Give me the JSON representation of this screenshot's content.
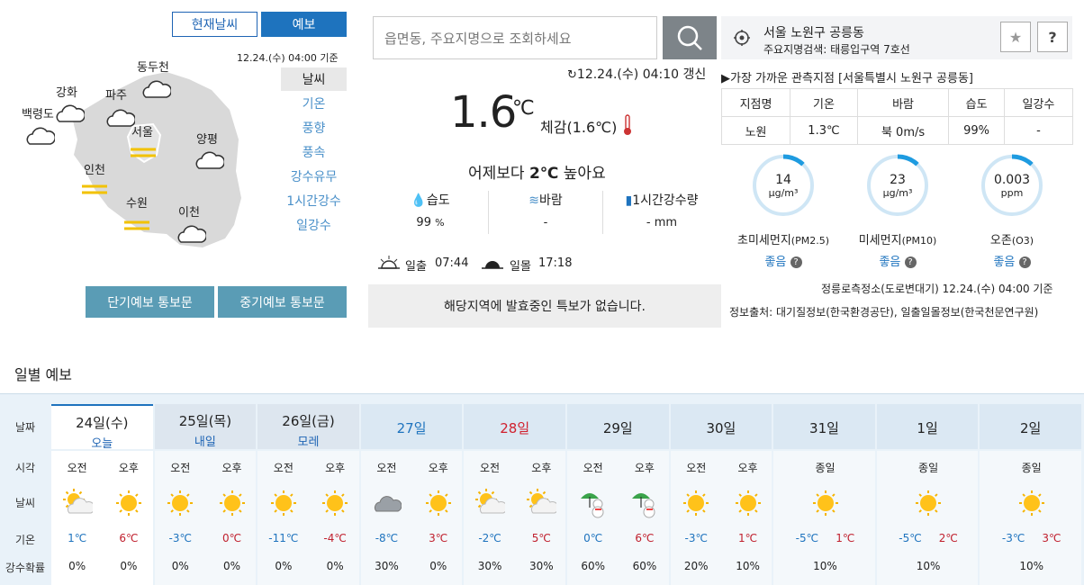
{
  "tabs": {
    "current": "현재날씨",
    "forecast": "예보"
  },
  "map": {
    "timestamp": "12.24.(수) 04:00 기준",
    "cities": [
      {
        "name": "동두천",
        "icon": "cloud-icon"
      },
      {
        "name": "강화",
        "icon": "cloud-icon"
      },
      {
        "name": "파주",
        "icon": "cloud-icon"
      },
      {
        "name": "백령도",
        "icon": "cloud-icon"
      },
      {
        "name": "서울",
        "icon": "fog-icon"
      },
      {
        "name": "양평",
        "icon": "cloud-icon"
      },
      {
        "name": "인천",
        "icon": "fog-icon"
      },
      {
        "name": "수원",
        "icon": "fog-icon"
      },
      {
        "name": "이천",
        "icon": "cloud-icon"
      }
    ],
    "menu": [
      "날씨",
      "기온",
      "풍향",
      "풍속",
      "강수유무",
      "1시간강수",
      "일강수"
    ],
    "short_report": "단기예보 통보문",
    "mid_report": "중기예보 통보문"
  },
  "search": {
    "placeholder": "읍면동, 주요지명으로 조회하세요"
  },
  "location": {
    "name": "서울 노원구 공릉동",
    "sub": "주요지명검색: 태릉입구역 7호선",
    "star": "★",
    "help": "?"
  },
  "current": {
    "updated": "12.24.(수) 04:10 갱신",
    "temp": "1.6",
    "unit": "℃",
    "feels": "체감(1.6℃)",
    "compare_pre": "어제보다 ",
    "compare_val": "2℃",
    "compare_post": " 높아요",
    "humidity_label": "습도",
    "humidity_value": "99",
    "humidity_unit": "%",
    "wind_label": "바람",
    "wind_value": "-",
    "rain_label": "1시간강수량",
    "rain_value": "- mm",
    "sunrise_label": "일출",
    "sunrise": "07:44",
    "sunset_label": "일몰",
    "sunset": "17:18",
    "warning": "해당지역에 발효중인 특보가 없습니다."
  },
  "observation": {
    "title": "▶가장 가까운 관측지점 [서울특별시 노원구 공릉동]",
    "headers": [
      "지점명",
      "기온",
      "바람",
      "습도",
      "일강수"
    ],
    "values": [
      "노원",
      "1.3℃",
      "북 0m/s",
      "99%",
      "-"
    ]
  },
  "air": [
    {
      "value": "14",
      "unit": "μg/m³",
      "name": "초미세먼지",
      "code": "(PM2.5)",
      "grade": "좋음",
      "fill": 0.12
    },
    {
      "value": "23",
      "unit": "μg/m³",
      "name": "미세먼지",
      "code": "(PM10)",
      "grade": "좋음",
      "fill": 0.12
    },
    {
      "value": "0.003",
      "unit": "ppm",
      "name": "오존",
      "code": "(O3)",
      "grade": "좋음",
      "fill": 0.12
    }
  ],
  "air_station": "정릉로측정소(도로변대기) 12.24.(수) 04:00 기준",
  "source": "정보출처: 대기질정보(한국환경공단), 일출일몰정보(한국천문연구원)",
  "daily": {
    "title": "일별 예보",
    "row_labels": [
      "날짜",
      "시각",
      "날씨",
      "기온",
      "강수확률"
    ],
    "am": "오전",
    "pm": "오후",
    "allday": "종일",
    "days": [
      {
        "day": "24일(수)",
        "sub": "오늘",
        "color": "#222",
        "am_icon": "partly-cloudy-icon",
        "pm_icon": "sun-icon",
        "am_t": "1℃",
        "pm_t": "6℃",
        "am_p": "0%",
        "pm_p": "0%"
      },
      {
        "day": "25일(목)",
        "sub": "내일",
        "color": "#222",
        "am_icon": "sun-icon",
        "pm_icon": "sun-icon",
        "am_t": "-3℃",
        "pm_t": "0℃",
        "am_p": "0%",
        "pm_p": "0%"
      },
      {
        "day": "26일(금)",
        "sub": "모레",
        "color": "#222",
        "am_icon": "sun-icon",
        "pm_icon": "sun-icon",
        "am_t": "-11℃",
        "pm_t": "-4℃",
        "am_p": "0%",
        "pm_p": "0%"
      },
      {
        "day": "27일",
        "sub": "",
        "color": "#1e73be",
        "am_icon": "cloud-icon",
        "pm_icon": "sun-icon",
        "am_t": "-8℃",
        "pm_t": "3℃",
        "am_p": "30%",
        "pm_p": "0%"
      },
      {
        "day": "28일",
        "sub": "",
        "color": "#d0202e",
        "am_icon": "partly-cloudy-icon",
        "pm_icon": "partly-cloudy-icon",
        "am_t": "-2℃",
        "pm_t": "5℃",
        "am_p": "30%",
        "pm_p": "30%"
      },
      {
        "day": "29일",
        "sub": "",
        "color": "#222",
        "am_icon": "snow-rain-icon",
        "pm_icon": "snow-rain-icon",
        "am_t": "0℃",
        "pm_t": "6℃",
        "am_p": "60%",
        "pm_p": "60%"
      },
      {
        "day": "30일",
        "sub": "",
        "color": "#222",
        "am_icon": "sun-icon",
        "pm_icon": "sun-icon",
        "am_t": "-3℃",
        "pm_t": "1℃",
        "am_p": "20%",
        "pm_p": "10%"
      },
      {
        "day": "31일",
        "sub": "",
        "color": "#222",
        "all": true,
        "icon": "sun-icon",
        "am_t": "-5℃",
        "pm_t": "1℃",
        "p": "10%"
      },
      {
        "day": "1일",
        "sub": "",
        "color": "#222",
        "all": true,
        "icon": "sun-icon",
        "am_t": "-5℃",
        "pm_t": "2℃",
        "p": "10%"
      },
      {
        "day": "2일",
        "sub": "",
        "color": "#222",
        "all": true,
        "icon": "sun-icon",
        "am_t": "-3℃",
        "pm_t": "3℃",
        "p": "10%"
      }
    ]
  }
}
